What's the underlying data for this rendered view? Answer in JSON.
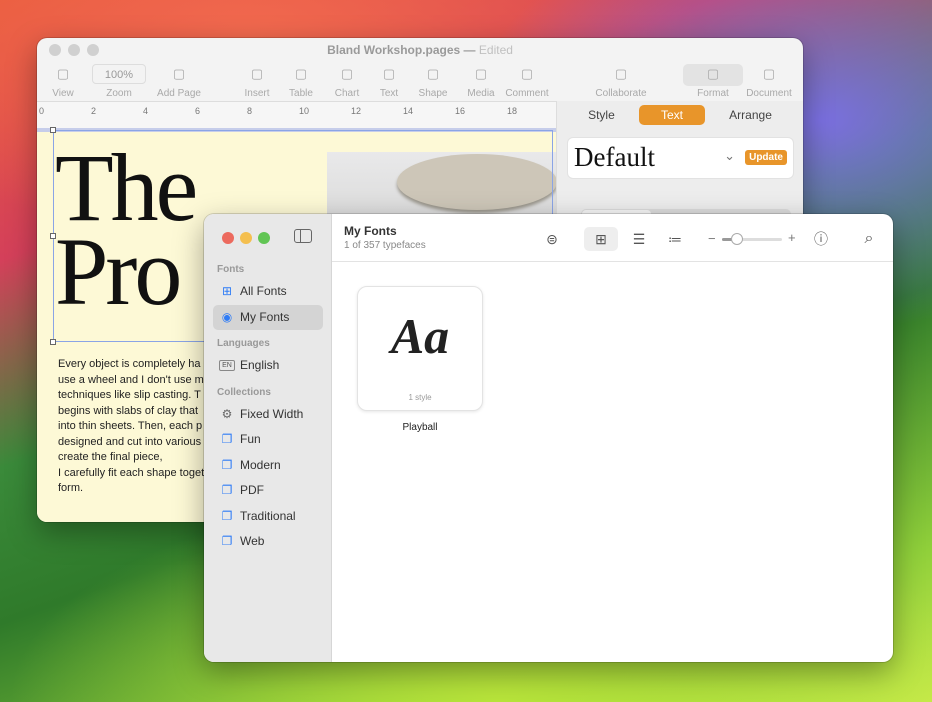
{
  "pages": {
    "title": "Bland Workshop.pages",
    "status": "Edited",
    "toolbar": [
      {
        "label": "View",
        "icon": "sidebar-icon"
      },
      {
        "label": "Zoom",
        "value": "100%"
      },
      {
        "label": "Add Page",
        "icon": "plus-icon"
      },
      {
        "label": "Insert",
        "icon": "insert-icon"
      },
      {
        "label": "Table",
        "icon": "table-icon"
      },
      {
        "label": "Chart",
        "icon": "chart-icon"
      },
      {
        "label": "Text",
        "icon": "text-icon"
      },
      {
        "label": "Shape",
        "icon": "shape-icon"
      },
      {
        "label": "Media",
        "icon": "media-icon"
      },
      {
        "label": "Comment",
        "icon": "comment-icon"
      },
      {
        "label": "Collaborate",
        "icon": "collaborate-icon"
      },
      {
        "label": "Format",
        "icon": "format-icon"
      },
      {
        "label": "Document",
        "icon": "document-icon"
      }
    ],
    "ruler": [
      "0",
      "2",
      "4",
      "6",
      "8",
      "10",
      "12",
      "14",
      "16",
      "18"
    ],
    "heading_lines": [
      "The",
      "Pro"
    ],
    "body_lines": [
      "Every object is completely ha",
      "use a wheel and I don't use m",
      "techniques like slip casting. T",
      "begins with slabs of clay that",
      "into thin sheets. Then, each p",
      "designed and cut into various",
      "create the final piece,",
      "I carefully fit each shape toget",
      "form."
    ],
    "inspector": {
      "tabs": [
        "Style",
        "Text",
        "Arrange"
      ],
      "active_tab": "Text",
      "paragraph_style": "Default",
      "update_label": "Update",
      "subtabs": [
        "Style",
        "Layout",
        "More"
      ]
    },
    "accent": "#e8952a"
  },
  "fontbook": {
    "title": "My Fonts",
    "subtitle": "1 of 357 typefaces",
    "sections": [
      {
        "header": "Fonts",
        "items": [
          {
            "label": "All Fonts",
            "icon": "grid-icon"
          },
          {
            "label": "My Fonts",
            "icon": "person-icon",
            "selected": true
          }
        ]
      },
      {
        "header": "Languages",
        "items": [
          {
            "label": "English",
            "icon": "en-badge-icon"
          }
        ]
      },
      {
        "header": "Collections",
        "items": [
          {
            "label": "Fixed Width",
            "icon": "gear-icon"
          },
          {
            "label": "Fun",
            "icon": "collection-icon"
          },
          {
            "label": "Modern",
            "icon": "collection-icon"
          },
          {
            "label": "PDF",
            "icon": "collection-icon"
          },
          {
            "label": "Traditional",
            "icon": "collection-icon"
          },
          {
            "label": "Web",
            "icon": "collection-icon"
          }
        ]
      }
    ],
    "en_badge": "EN",
    "size_slider": 0.25,
    "font_card": {
      "sample": "Aa",
      "styles": "1 style",
      "name": "Playball"
    }
  }
}
